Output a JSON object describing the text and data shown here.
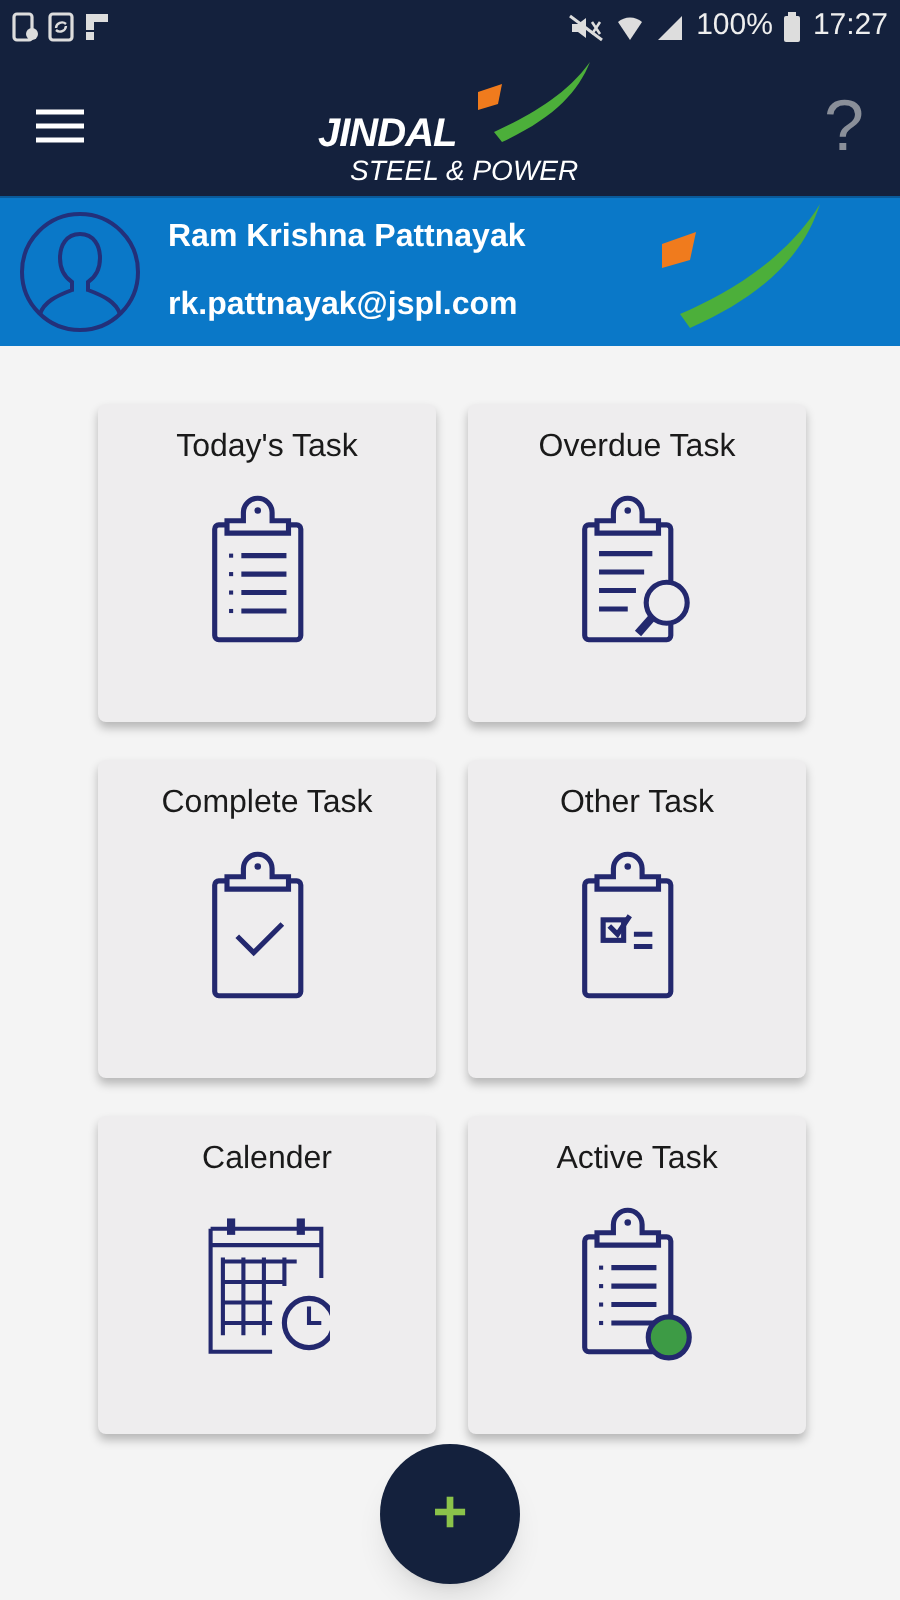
{
  "status_bar": {
    "battery": "100%",
    "time": "17:27"
  },
  "header": {
    "logo_title": "JINDAL",
    "logo_subtitle": "STEEL & POWER",
    "help": "?"
  },
  "user": {
    "name": "Ram Krishna Pattnayak",
    "email": "rk.pattnayak@jspl.com"
  },
  "tiles": [
    {
      "label": "Today's Task",
      "kind": "list"
    },
    {
      "label": "Overdue Task",
      "kind": "search"
    },
    {
      "label": "Complete Task",
      "kind": "check"
    },
    {
      "label": "Other Task",
      "kind": "checklist"
    },
    {
      "label": "Calender",
      "kind": "calendar"
    },
    {
      "label": "Active Task",
      "kind": "active"
    }
  ],
  "fab": {
    "label": "+"
  }
}
